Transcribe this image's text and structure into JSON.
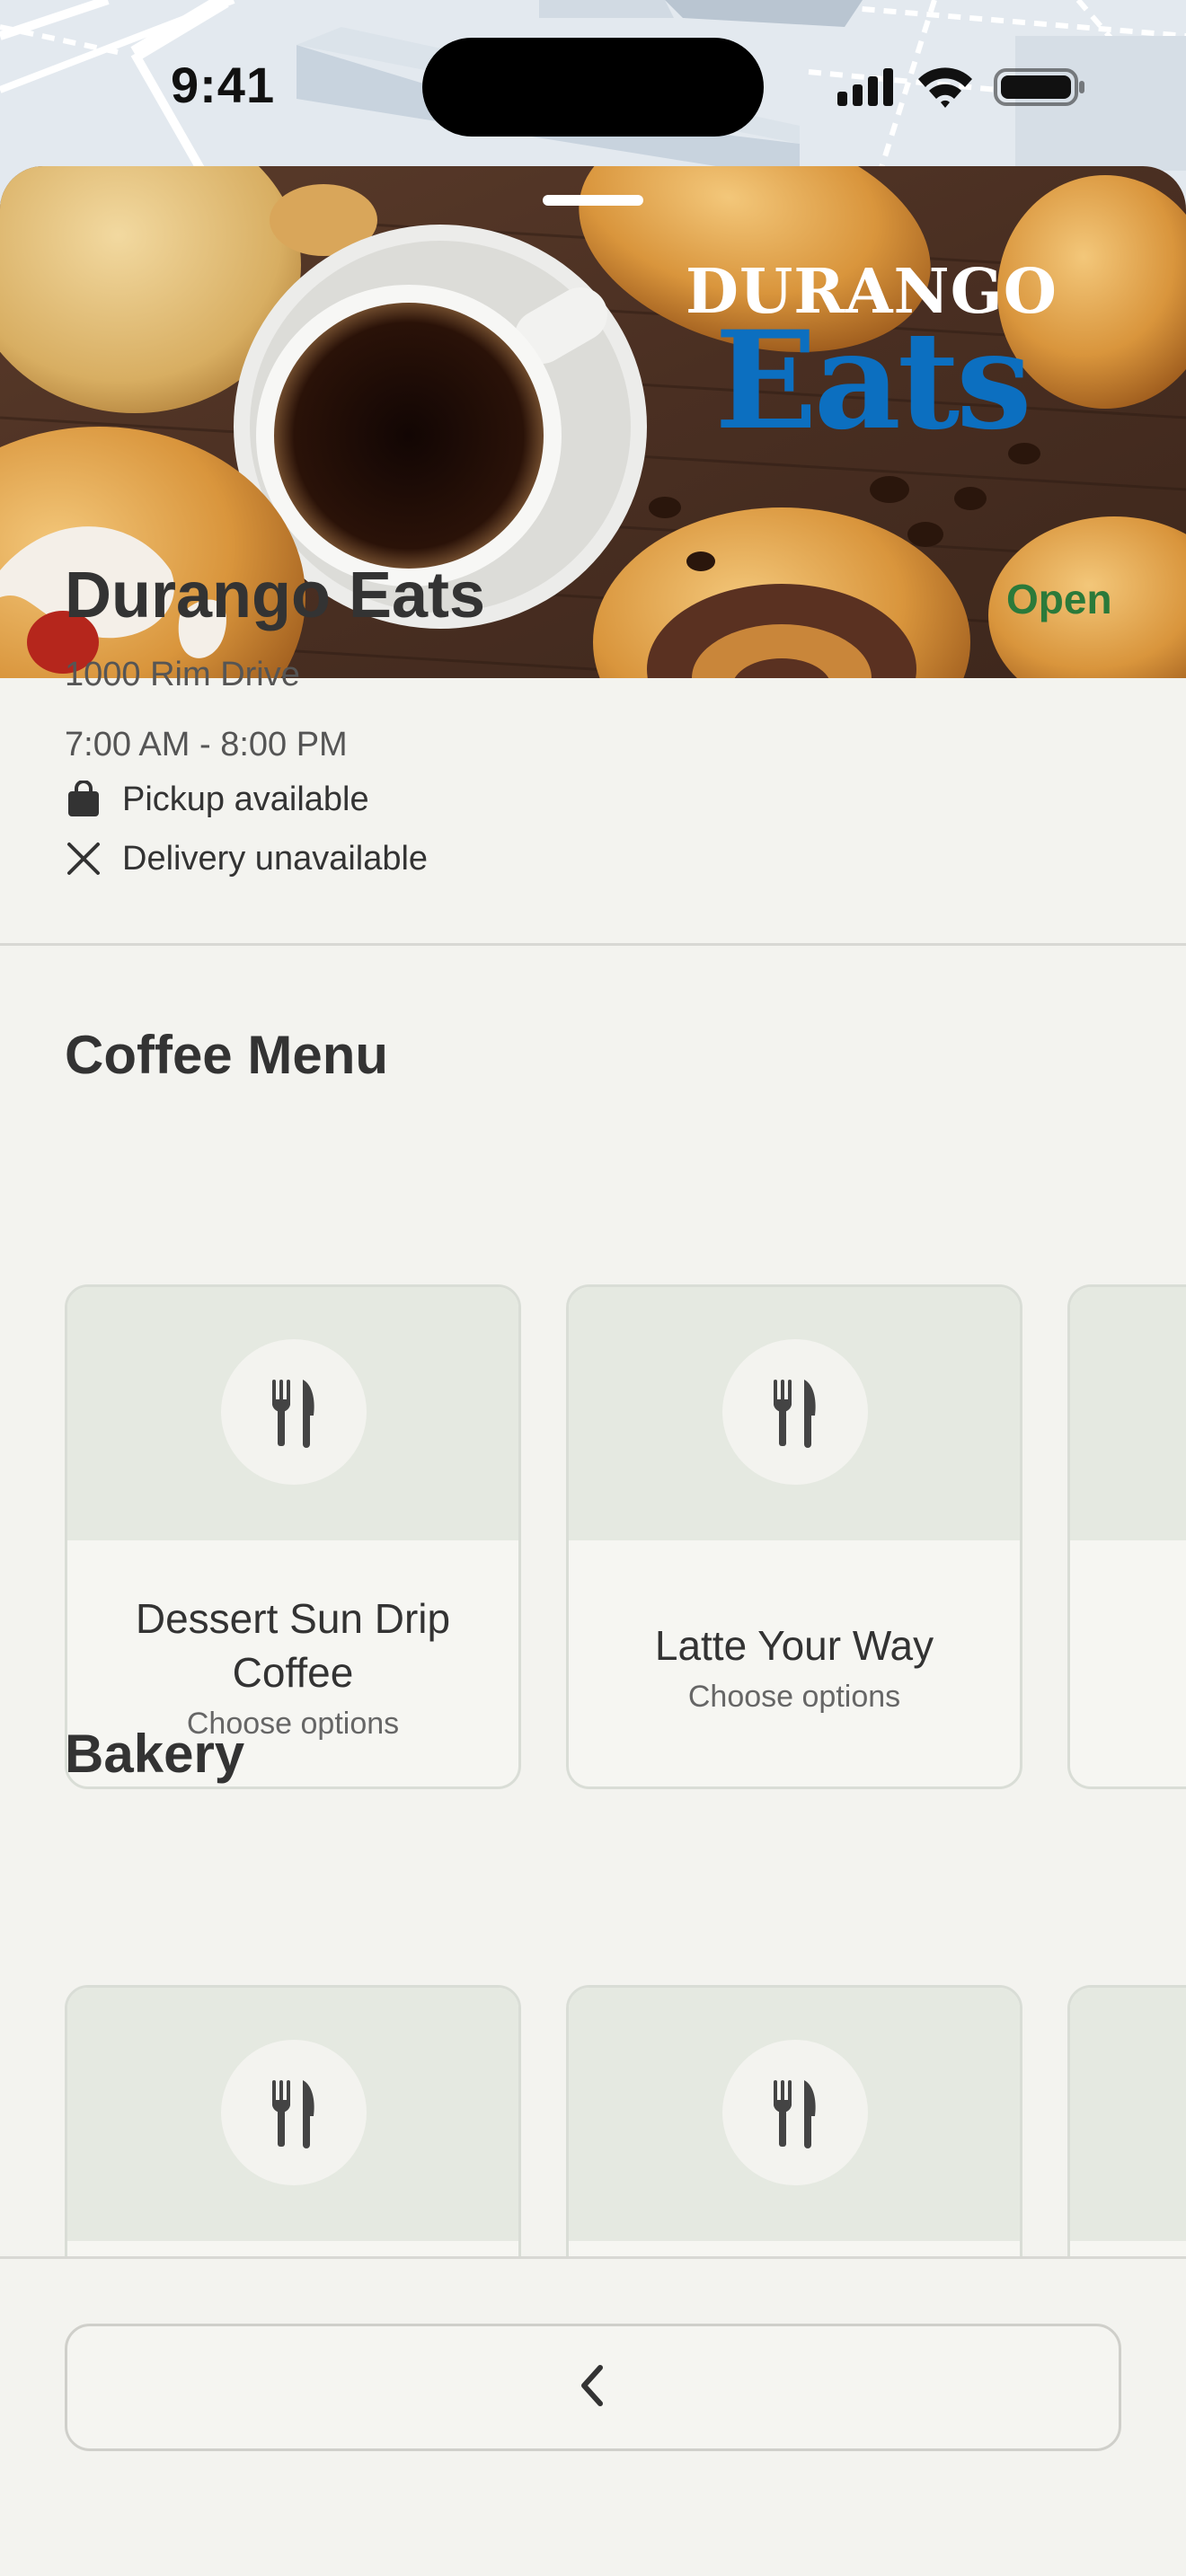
{
  "status_bar": {
    "time": "9:41"
  },
  "hero": {
    "logo_top": "DURANGO",
    "logo_bottom": "Eats"
  },
  "store": {
    "name": "Durango Eats",
    "status": "Open",
    "address": "1000 Rim Drive",
    "hours": "7:00 AM - 8:00 PM",
    "features": [
      {
        "icon": "bag-icon",
        "label": "Pickup available"
      },
      {
        "icon": "close-icon",
        "label": "Delivery unavailable"
      }
    ]
  },
  "sections": [
    {
      "title": "Coffee Menu",
      "items": [
        {
          "name": "Dessert Sun Drip Coffee",
          "options": "Choose options"
        },
        {
          "name": "Latte Your Way",
          "options": "Choose options"
        }
      ]
    },
    {
      "title": "Bakery",
      "items": []
    }
  ],
  "colors": {
    "accent_green": "#2b7a3a",
    "logo_blue": "#0c6fc0",
    "card_top": "#e5e9e1"
  }
}
